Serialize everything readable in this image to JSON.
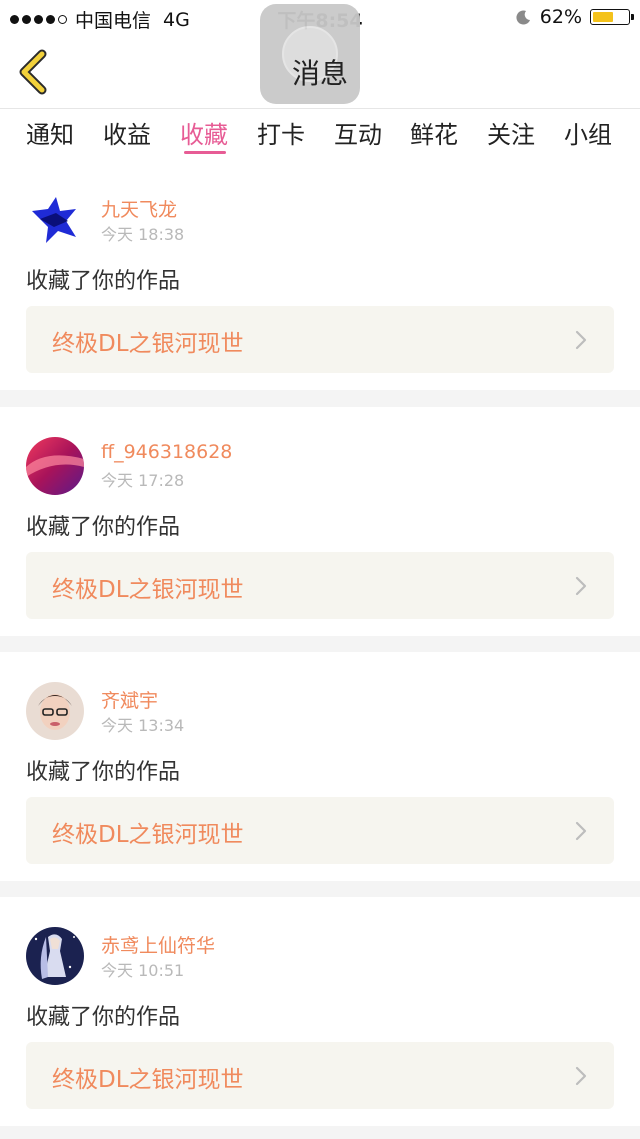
{
  "status_bar": {
    "carrier": "中国电信",
    "network": "4G",
    "time": "下午8:54",
    "battery_percent": "62%",
    "battery_level": 0.62,
    "battery_color": "#f4c21b",
    "moon_icon": "moon-icon"
  },
  "navbar": {
    "title": "消息",
    "back_icon": "chevron-left-icon"
  },
  "tabs": [
    {
      "label": "通知"
    },
    {
      "label": "收益"
    },
    {
      "label": "收藏"
    },
    {
      "label": "打卡"
    },
    {
      "label": "互动"
    },
    {
      "label": "鲜花"
    },
    {
      "label": "关注"
    },
    {
      "label": "小组"
    }
  ],
  "active_tab": "收藏",
  "accent_color": "#e75c95",
  "name_color": "#f08a5d",
  "notifications": [
    {
      "username": "九天飞龙",
      "time": "今天 18:38",
      "action": "收藏了你的作品",
      "work_title": "终极DL之银河现世"
    },
    {
      "username": "ff_946318628",
      "time": "今天 17:28",
      "action": "收藏了你的作品",
      "work_title": "终极DL之银河现世"
    },
    {
      "username": "齐斌宇",
      "time": "今天 13:34",
      "action": "收藏了你的作品",
      "work_title": "终极DL之银河现世"
    },
    {
      "username": "赤鸢上仙符华",
      "time": "今天 10:51",
      "action": "收藏了你的作品",
      "work_title": "终极DL之银河现世"
    }
  ]
}
